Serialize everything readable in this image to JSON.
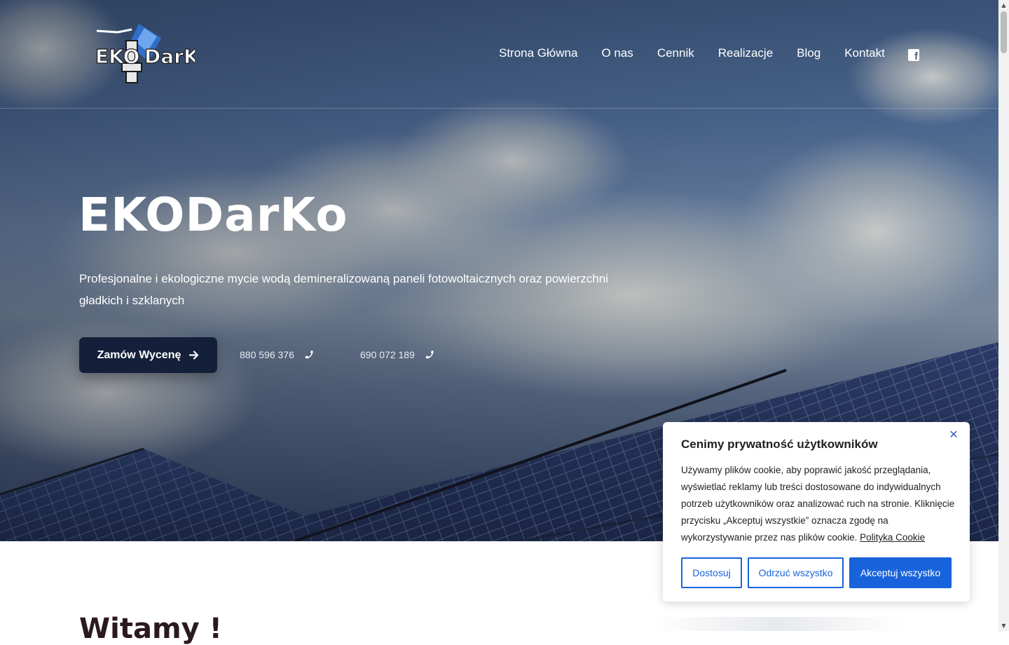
{
  "header": {
    "logo_text": "EKO DarKo",
    "nav": [
      {
        "label": "Strona Główna"
      },
      {
        "label": "O nas"
      },
      {
        "label": "Cennik"
      },
      {
        "label": "Realizacje"
      },
      {
        "label": "Blog"
      },
      {
        "label": "Kontakt"
      }
    ],
    "social_icon": "facebook-icon"
  },
  "hero": {
    "title": "EKODarKo",
    "subtitle": "Profesjonalne i ekologiczne mycie wodą demineralizowaną paneli fotowoltaicznych oraz powierzchni gładkich i szklanych",
    "cta_label": "Zamów Wycenę",
    "phones": [
      "880 596 376",
      "690 072 189"
    ]
  },
  "section": {
    "heading": "Witamy !"
  },
  "cookie": {
    "title": "Cenimy prywatność użytkowników",
    "text": "Używamy plików cookie, aby poprawić jakość przeglądania, wyświetlać reklamy lub treści dostosowane do indywidualnych potrzeb użytkowników oraz analizować ruch na stronie. Kliknięcie przycisku „Akceptuj wszystkie” oznacza zgodę na wykorzystywanie przez nas plików cookie.",
    "link_label": "Polityka Cookie",
    "buttons": {
      "customize": "Dostosuj",
      "reject": "Odrzuć wszystko",
      "accept": "Akceptuj wszystko"
    }
  },
  "colors": {
    "accent": "#1863dc",
    "cta_bg": "#14203a",
    "heading_dark": "#2a1a1f"
  }
}
